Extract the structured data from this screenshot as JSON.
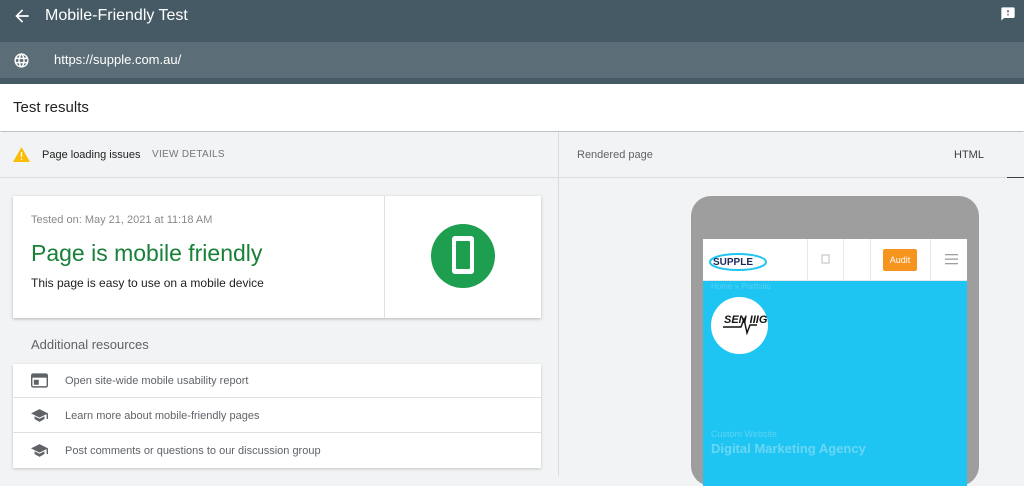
{
  "header": {
    "title": "Mobile-Friendly Test",
    "back_icon": "arrow-back-icon",
    "feedback_icon": "feedback-icon",
    "url": "https://supple.com.au/",
    "globe_icon": "globe-icon"
  },
  "results": {
    "title": "Test results"
  },
  "issues": {
    "label": "Page loading issues",
    "action": "VIEW DETAILS",
    "icon": "warning-icon"
  },
  "summary": {
    "tested_on": "Tested on: May 21, 2021 at 11:18 AM",
    "headline": "Page is mobile friendly",
    "sub": "This page is easy to use on a mobile device",
    "badge_icon": "mobile-phone-icon"
  },
  "resources": {
    "title": "Additional resources",
    "items": [
      {
        "label": "Open site-wide mobile usability report",
        "icon": "report-icon"
      },
      {
        "label": "Learn more about mobile-friendly pages",
        "icon": "school-icon"
      },
      {
        "label": "Post comments or questions to our discussion group",
        "icon": "school-icon"
      }
    ]
  },
  "rendered": {
    "label": "Rendered page",
    "html_tab": "HTML",
    "site": {
      "logo_text": "SUPPLE",
      "audit_button": "Audit",
      "crumb": "Home » Portfolio",
      "client_logo_text": "SEN IIIG",
      "subtitle": "Custom Website",
      "hero_title": "Digital Marketing Agency"
    }
  },
  "colors": {
    "appbar": "#455a64",
    "success": "#188038",
    "badge": "#1e9e4f",
    "warning": "#fbbc04",
    "hero": "#1ec5f3",
    "audit": "#f7941d"
  }
}
